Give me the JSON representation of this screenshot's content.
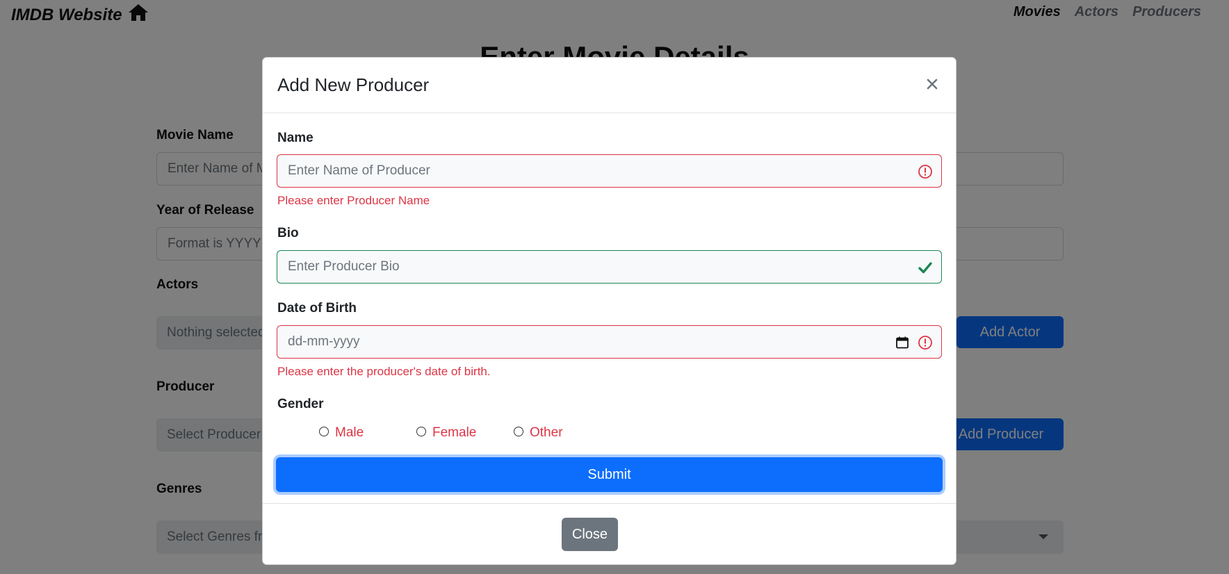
{
  "navbar": {
    "brand": "IMDB Website",
    "links": [
      {
        "label": "Movies",
        "active": true
      },
      {
        "label": "Actors",
        "active": false
      },
      {
        "label": "Producers",
        "active": false
      }
    ]
  },
  "page": {
    "title": "Enter Movie Details",
    "movie_name_label": "Movie Name",
    "movie_name_placeholder": "Enter Name of Movie",
    "year_label": "Year of Release",
    "year_placeholder": "Format is YYYY",
    "actors_label": "Actors",
    "actors_placeholder": "Nothing selected",
    "add_actor_button": "Add Actor",
    "producer_label": "Producer",
    "producer_placeholder": "Select Producer",
    "add_producer_button": "Add Producer",
    "genres_label": "Genres",
    "genres_placeholder": "Select Genres from list"
  },
  "modal": {
    "title": "Add New Producer",
    "name_label": "Name",
    "name_placeholder": "Enter Name of Producer",
    "name_error": "Please enter Producer Name",
    "bio_label": "Bio",
    "bio_placeholder": "Enter Producer Bio",
    "dob_label": "Date of Birth",
    "dob_placeholder": "dd-mm-yyyy",
    "dob_error": "Please enter the producer's date of birth.",
    "gender_label": "Gender",
    "gender_options": [
      "Male",
      "Female",
      "Other"
    ],
    "submit_label": "Submit",
    "close_label": "Close"
  },
  "colors": {
    "primary": "#0d6efd",
    "danger": "#dc3545",
    "success": "#198754",
    "secondary": "#6c757d"
  }
}
